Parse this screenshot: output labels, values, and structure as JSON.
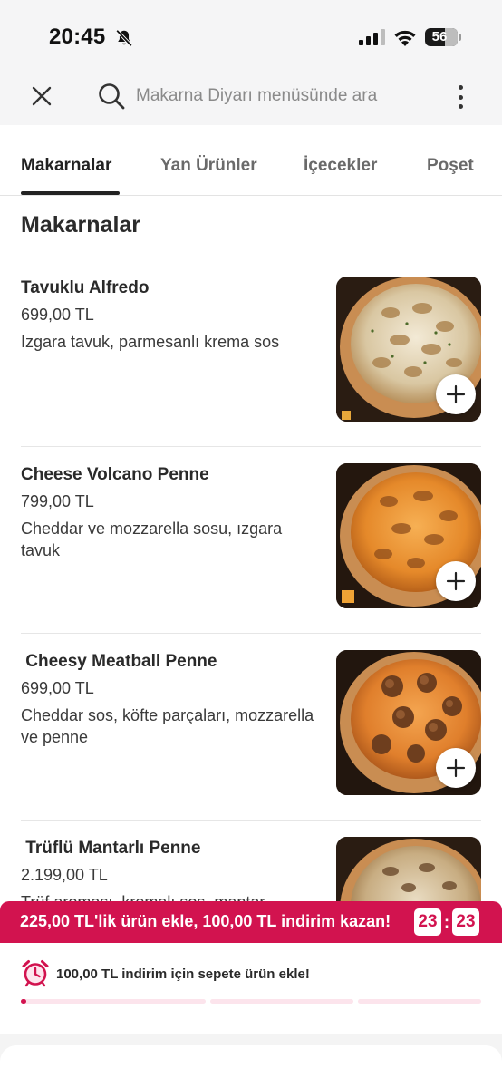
{
  "status_bar": {
    "time": "20:45",
    "battery": "56",
    "battery_level": 0.56
  },
  "search": {
    "placeholder": "Makarna Diyarı menüsünde ara"
  },
  "tabs": [
    {
      "label": "Makarnalar",
      "active": true
    },
    {
      "label": "Yan Ürünler",
      "active": false
    },
    {
      "label": "İçecekler",
      "active": false
    },
    {
      "label": "Poşet",
      "active": false
    }
  ],
  "section": {
    "title": "Makarnalar"
  },
  "products": [
    {
      "name": "Tavuklu Alfredo",
      "price": "699,00 TL",
      "description": "Izgara tavuk, parmesanlı krema sos",
      "image_icon": "alfredo-pasta-photo"
    },
    {
      "name": "Cheese Volcano Penne",
      "price": "799,00 TL",
      "description": "Cheddar ve mozzarella sosu, ızgara tavuk",
      "image_icon": "cheese-penne-photo"
    },
    {
      "name": " Cheesy Meatball Penne",
      "price": "699,00 TL",
      "description": "Cheddar sos, köfte parçaları, mozzarella ve penne",
      "image_icon": "meatball-penne-photo"
    },
    {
      "name": " Trüflü Mantarlı Penne",
      "price": "2.199,00 TL",
      "description": "Trüf aroması, kremalı sos, mantar",
      "image_icon": "truffle-penne-photo"
    }
  ],
  "promo": {
    "banner_text": "225,00 TL'lik ürün ekle, 100,00 TL indirim kazan!",
    "timer_minutes": "23",
    "timer_seconds": "23",
    "message": "100,00 TL indirim için sepete ürün ekle!",
    "progress": 0.01,
    "accent_color": "#d2134f"
  }
}
